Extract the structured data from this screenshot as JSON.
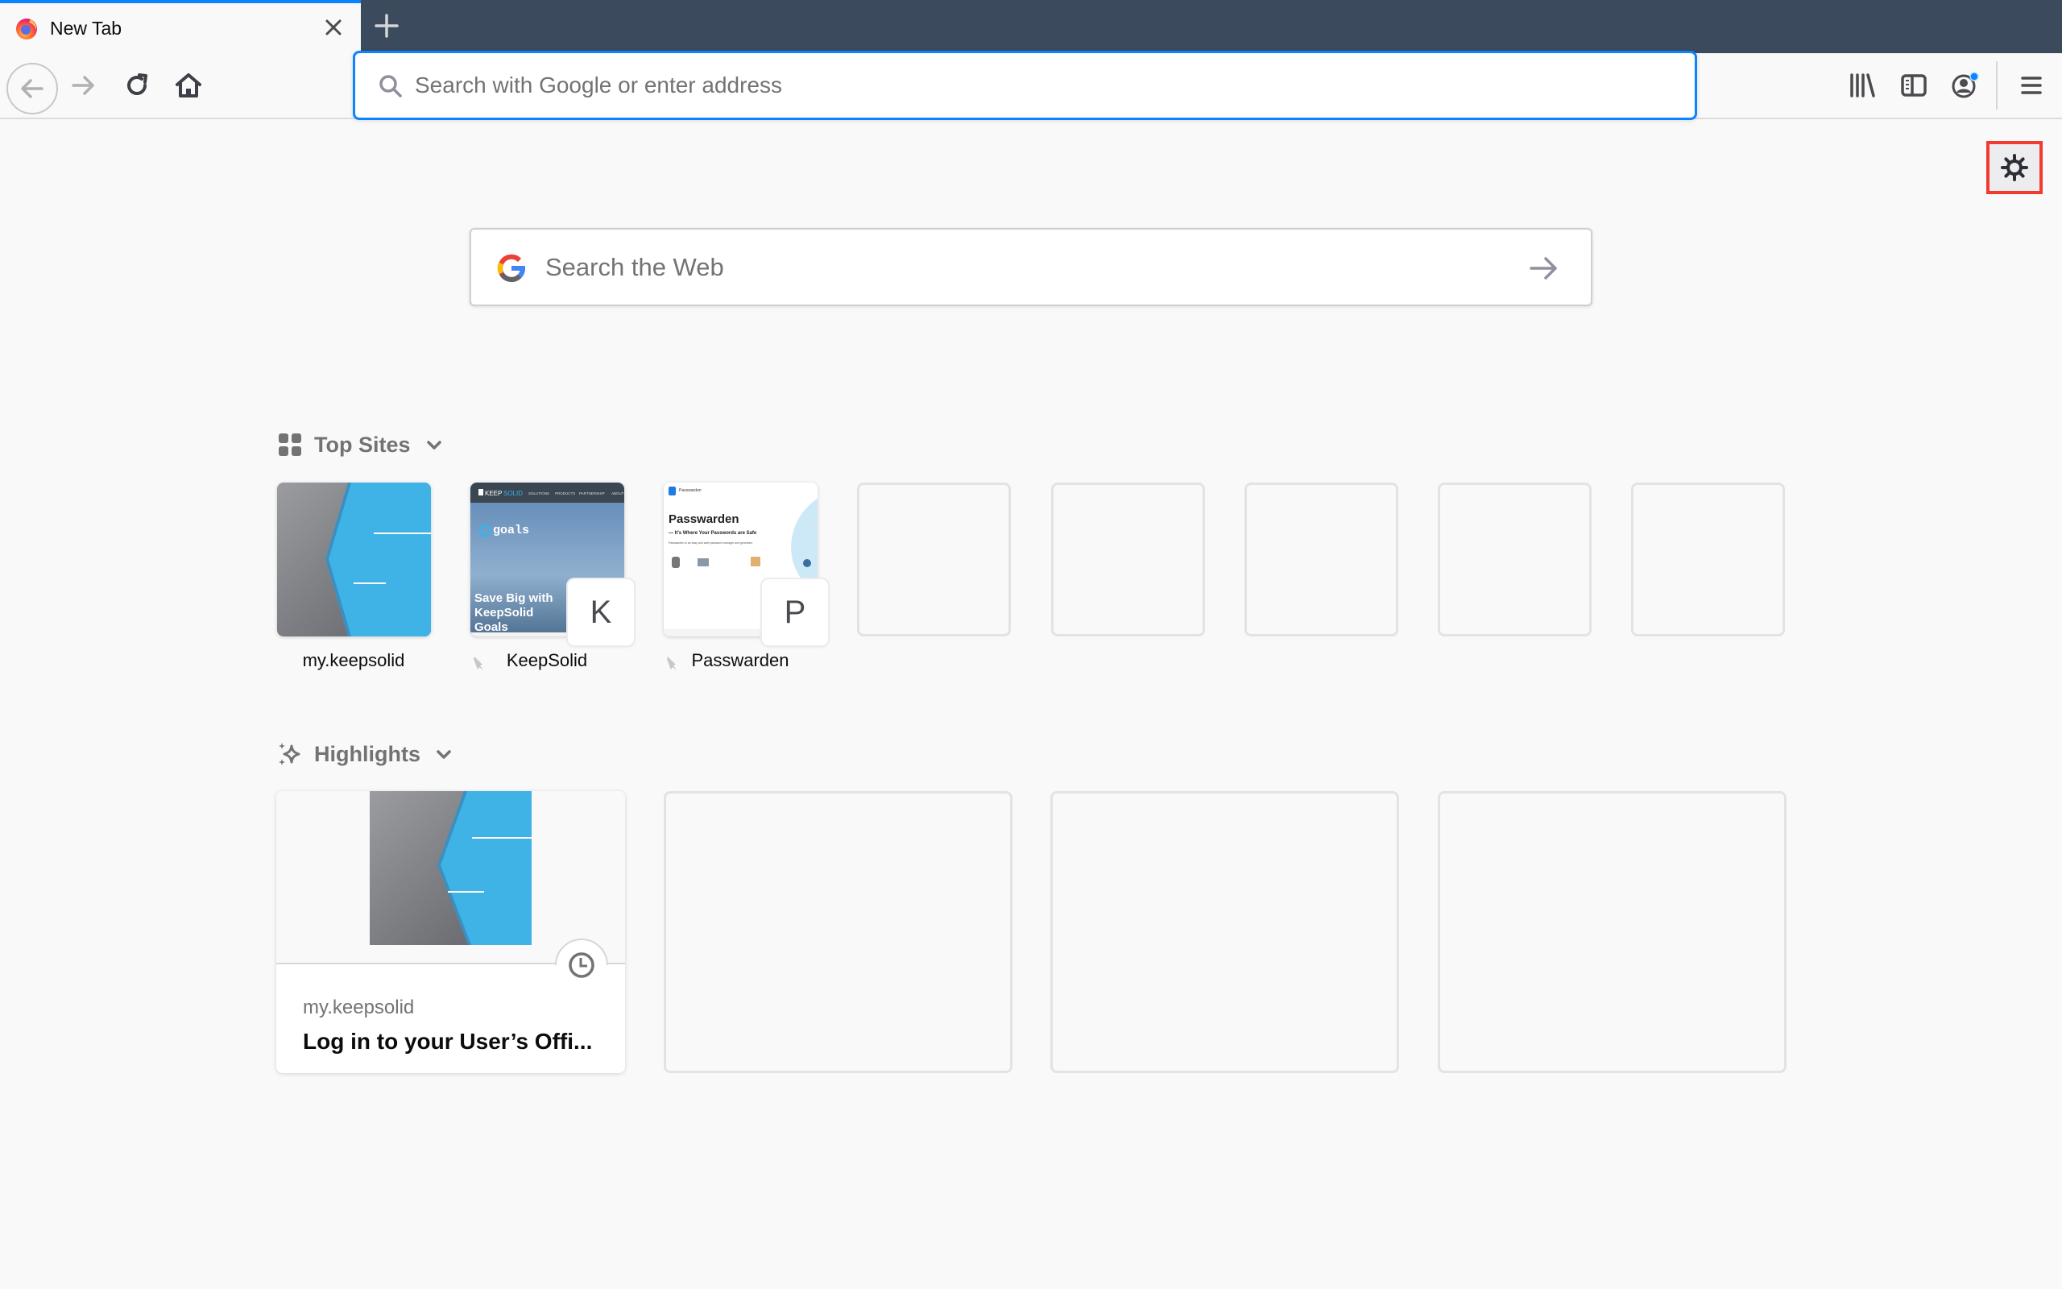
{
  "tab": {
    "title": "New Tab",
    "favicon": "firefox-logo-icon",
    "close_icon": "close-icon"
  },
  "tabstrip": {
    "new_tab_icon": "plus-icon"
  },
  "toolbar": {
    "back_icon": "arrow-left-icon",
    "forward_icon": "arrow-right-icon",
    "reload_icon": "reload-icon",
    "home_icon": "home-icon",
    "library_icon": "library-icon",
    "sidebar_icon": "sidebar-icon",
    "account_icon": "account-icon",
    "menu_icon": "hamburger-menu-icon"
  },
  "urlbar": {
    "placeholder": "Search with Google or enter address",
    "value": ""
  },
  "settings": {
    "icon": "gear-icon"
  },
  "websearch": {
    "placeholder": "Search the Web",
    "engine": "Google"
  },
  "top_sites": {
    "title": "Top Sites",
    "tiles": [
      {
        "label": "my.keepsolid",
        "pinned": false
      },
      {
        "label": "KeepSolid",
        "pinned": true,
        "letter": "K",
        "thumb": {
          "nav": [
            "SOLUTIONS",
            "PRODUCTS",
            "PARTNERSHIP",
            "ABOUT"
          ],
          "brand_a": "KEEP",
          "brand_b": "SOLID",
          "product": "goals",
          "headline_1": "Save Big with",
          "headline_2": "KeepSolid",
          "headline_3": "Goals"
        }
      },
      {
        "label": "Passwarden",
        "pinned": true,
        "letter": "P",
        "thumb": {
          "brand": "Passwarden",
          "heading": "Passwarden",
          "subheading": "— It's Where Your Passwords are Safe",
          "body": "Passwarden is an easy and safe password manager and generator."
        }
      },
      {
        "label": ""
      },
      {
        "label": ""
      },
      {
        "label": ""
      },
      {
        "label": ""
      },
      {
        "label": ""
      }
    ]
  },
  "highlights": {
    "title": "Highlights",
    "cards": [
      {
        "host": "my.keepsolid",
        "title": "Log in to your User’s Offi...",
        "type_icon": "clock-icon"
      },
      {},
      {},
      {}
    ]
  },
  "colors": {
    "accent": "#0a84ff",
    "tabstrip": "#3b4a5c",
    "page_bg": "#f9f9fa",
    "highlight_box": "#f23a2f",
    "keepsolid_blue": "#3cb1e6"
  }
}
